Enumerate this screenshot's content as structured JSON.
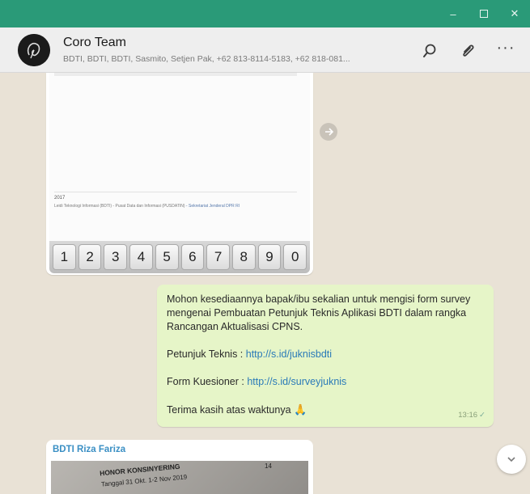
{
  "window": {
    "minimize": "–",
    "close": "✕"
  },
  "header": {
    "title": "Coro Team",
    "subtitle": "BDTI, BDTI, BDTI, Sasmito, Setjen Pak, +62 813-8114-5183, +62 818-081...",
    "menu": "···",
    "icons": [
      "search-icon",
      "paperclip-icon",
      "more-icon"
    ]
  },
  "image_message": {
    "doc_year": "2017",
    "doc_line": "Leidi Teknologi Informasi (BDTI) - Pusat Data dan Informasi (PUSDATIN)",
    "doc_line_link": " - Sekretariat Jenderal DPR RI",
    "keys": [
      "1",
      "2",
      "3",
      "4",
      "5",
      "6",
      "7",
      "8",
      "9",
      "0"
    ]
  },
  "outgoing_message": {
    "line1": "Mohon kesediaannya bapak/ibu sekalian untuk mengisi form survey mengenai Pembuatan Petunjuk Teknis Aplikasi BDTI dalam rangka Rancangan Aktualisasi CPNS.",
    "juknis_label": "Petunjuk Teknis : ",
    "juknis_link": "http://s.id/juknisbdti",
    "form_label": "Form Kuesioner : ",
    "form_link": "http://s.id/surveyjuknis",
    "thanks": "Terima kasih atas waktunya",
    "emoji": "🙏",
    "time": "13:16",
    "tick": "✓"
  },
  "incoming_message": {
    "sender": "BDTI Riza Fariza",
    "photo_text1": "HONOR KONSINYERING",
    "photo_text2": "Tanggal 31 Okt. 1-2 Nov 2019",
    "photo_num": "14"
  },
  "colors": {
    "titlebar": "#2a9a78",
    "outgoing_bubble": "#e6f5c8",
    "link": "#2a7ab8",
    "sender": "#3a8fc4"
  }
}
